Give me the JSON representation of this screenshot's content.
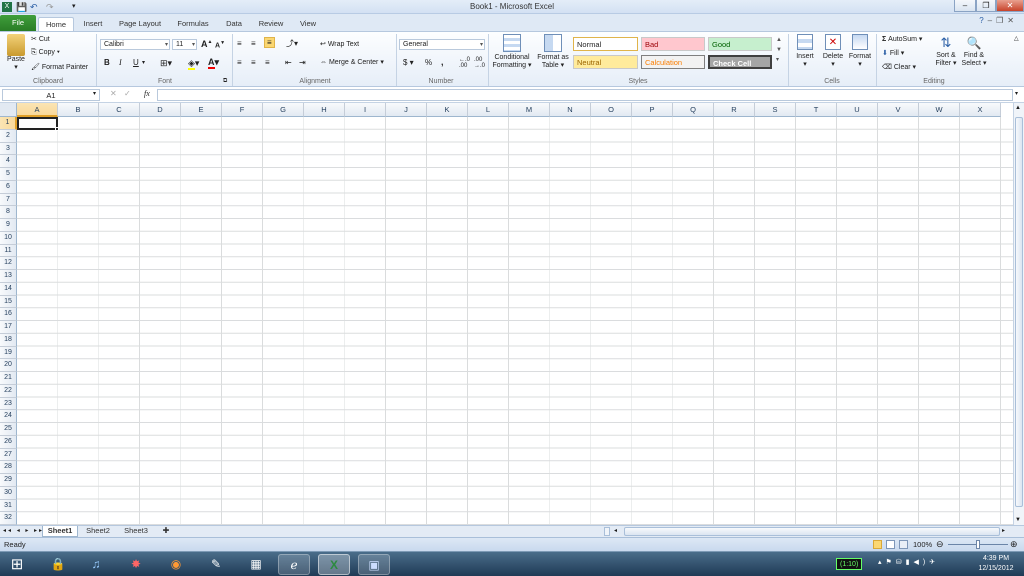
{
  "window": {
    "title": "Book1 - Microsoft Excel",
    "min": "–",
    "max": "❐",
    "close": "✕"
  },
  "ribbon_tabs": [
    "File",
    "Home",
    "Insert",
    "Page Layout",
    "Formulas",
    "Data",
    "Review",
    "View"
  ],
  "clipboard": {
    "paste": "Paste",
    "cut": "Cut",
    "copy": "Copy",
    "format_painter": "Format Painter",
    "label": "Clipboard"
  },
  "font": {
    "name": "Calibri",
    "size": "11",
    "bold": "B",
    "italic": "I",
    "underline": "U",
    "label": "Font",
    "grow": "A",
    "shrink": "A",
    "color_a": "A"
  },
  "alignment": {
    "wrap": "Wrap Text",
    "merge": "Merge & Center",
    "label": "Alignment"
  },
  "number": {
    "format": "General",
    "dollar": "$",
    "percent": "%",
    "comma": ",",
    "label": "Number"
  },
  "styles": {
    "conditional": "Conditional Formatting",
    "format_table": "Format as Table",
    "normal": "Normal",
    "bad": "Bad",
    "good": "Good",
    "neutral": "Neutral",
    "calculation": "Calculation",
    "check": "Check Cell",
    "label": "Styles"
  },
  "cells_grp": {
    "insert": "Insert",
    "delete": "Delete",
    "format": "Format",
    "label": "Cells"
  },
  "editing": {
    "autosum": "AutoSum",
    "fill": "Fill",
    "clear": "Clear",
    "sort": "Sort & Filter",
    "find": "Find & Select",
    "label": "Editing"
  },
  "formula_bar": {
    "name_box": "A1",
    "fx": "fx",
    "value": ""
  },
  "columns": [
    "A",
    "B",
    "C",
    "D",
    "E",
    "F",
    "G",
    "H",
    "I",
    "J",
    "K",
    "L",
    "M",
    "N",
    "O",
    "P",
    "Q",
    "R",
    "S",
    "T",
    "U",
    "V",
    "W",
    "X"
  ],
  "rows": [
    "1",
    "2",
    "3",
    "4",
    "5",
    "6",
    "7",
    "8",
    "9",
    "10",
    "11",
    "12",
    "13",
    "14",
    "15",
    "16",
    "17",
    "18",
    "19",
    "20",
    "21",
    "22",
    "23",
    "24",
    "25",
    "26",
    "27",
    "28",
    "29",
    "30",
    "31",
    "32"
  ],
  "sheets": [
    "Sheet1",
    "Sheet2",
    "Sheet3"
  ],
  "status": {
    "ready": "Ready",
    "zoom": "100%"
  },
  "clock": {
    "time": "4:39 PM",
    "date": "12/15/2012"
  },
  "tray": {
    "battery": "(1:10)"
  },
  "colors": {
    "file_tab": "#2a7d26",
    "accent": "#dfe9f5",
    "active_col": "#f9d99a"
  }
}
